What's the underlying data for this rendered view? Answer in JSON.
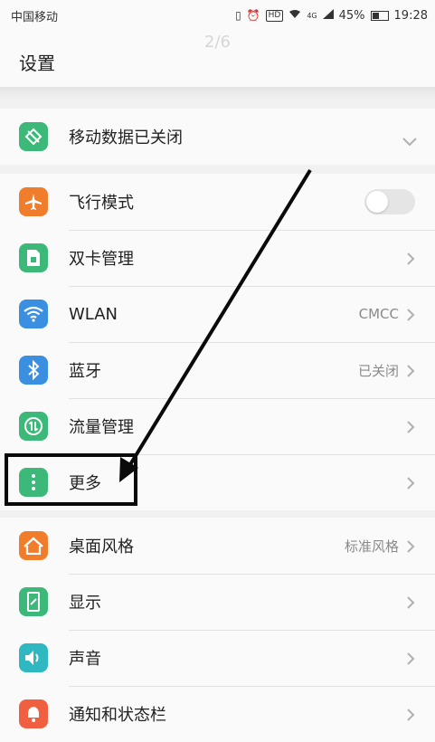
{
  "status_bar": {
    "carrier": "中国移动",
    "network": "4G",
    "hd": "HD",
    "battery": "45%",
    "battery_level": 0.45,
    "time": "19:28"
  },
  "page_indicator": "2/6",
  "header": {
    "title": "设置"
  },
  "groups": [
    [
      {
        "label": "移动数据已关闭",
        "icon": "mobile-data-off-icon",
        "color": "#3cb878",
        "control": "chevron-down"
      }
    ],
    [
      {
        "label": "飞行模式",
        "icon": "airplane-icon",
        "color": "#f07d2c",
        "control": "toggle",
        "toggle_on": false
      },
      {
        "label": "双卡管理",
        "icon": "sim-card-icon",
        "color": "#3cb878",
        "control": "chevron"
      },
      {
        "label": "WLAN",
        "icon": "wifi-icon",
        "color": "#3b8fe0",
        "control": "chevron",
        "value": "CMCC"
      },
      {
        "label": "蓝牙",
        "icon": "bluetooth-icon",
        "color": "#3b8fe0",
        "control": "chevron",
        "value": "已关闭"
      },
      {
        "label": "流量管理",
        "icon": "data-usage-icon",
        "color": "#3cb878",
        "control": "chevron"
      },
      {
        "label": "更多",
        "icon": "more-icon",
        "color": "#3cb878",
        "control": "chevron"
      }
    ],
    [
      {
        "label": "桌面风格",
        "icon": "home-style-icon",
        "color": "#f07d2c",
        "control": "chevron",
        "value": "标准风格"
      },
      {
        "label": "显示",
        "icon": "display-icon",
        "color": "#3cb878",
        "control": "chevron"
      },
      {
        "label": "声音",
        "icon": "sound-icon",
        "color": "#2fb8c2",
        "control": "chevron"
      },
      {
        "label": "通知和状态栏",
        "icon": "notification-icon",
        "color": "#f06040",
        "control": "chevron"
      }
    ]
  ]
}
